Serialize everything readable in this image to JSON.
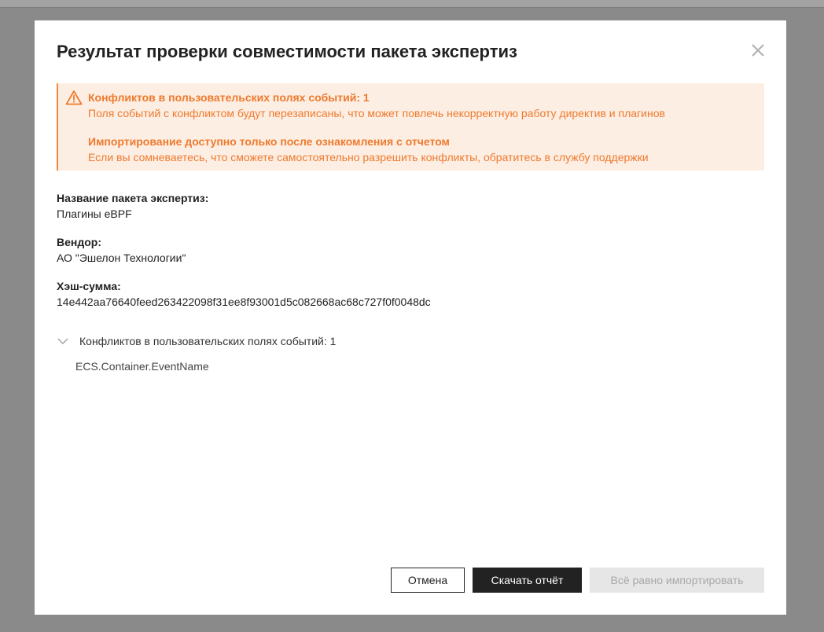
{
  "dialog": {
    "title": "Результат проверки совместимости пакета экспертиз",
    "close_icon": "close-icon"
  },
  "alert": {
    "icon": "warning-triangle-icon",
    "color": "#ee7a2c",
    "background": "#fdeee4",
    "blocks": [
      {
        "title": "Конфликтов в пользовательских полях событий: 1",
        "text": "Поля событий с конфликтом будут перезаписаны, что может повлечь некорректную работу директив и плагинов"
      },
      {
        "title": "Импортирование доступно только после ознакомления с отчетом",
        "text": "Если вы сомневаетесь, что сможете самостоятельно разрешить конфликты, обратитесь в службу поддержки"
      }
    ]
  },
  "details": {
    "package_name": {
      "label": "Название пакета экспертиз:",
      "value": "Плагины eBPF"
    },
    "vendor": {
      "label": "Вендор:",
      "value": "АО \"Эшелон Технологии\""
    },
    "hash": {
      "label": "Хэш-сумма:",
      "value": "14e442aa76640feed263422098f31ee8f93001d5c082668ac68c727f0f0048dc"
    }
  },
  "conflicts": {
    "icon": "chevron-down-icon",
    "header": "Конфликтов в пользовательских полях событий: 1",
    "items": [
      "ECS.Container.EventName"
    ]
  },
  "footer": {
    "cancel_label": "Отмена",
    "download_label": "Скачать отчёт",
    "import_label": "Всё равно импортировать"
  }
}
